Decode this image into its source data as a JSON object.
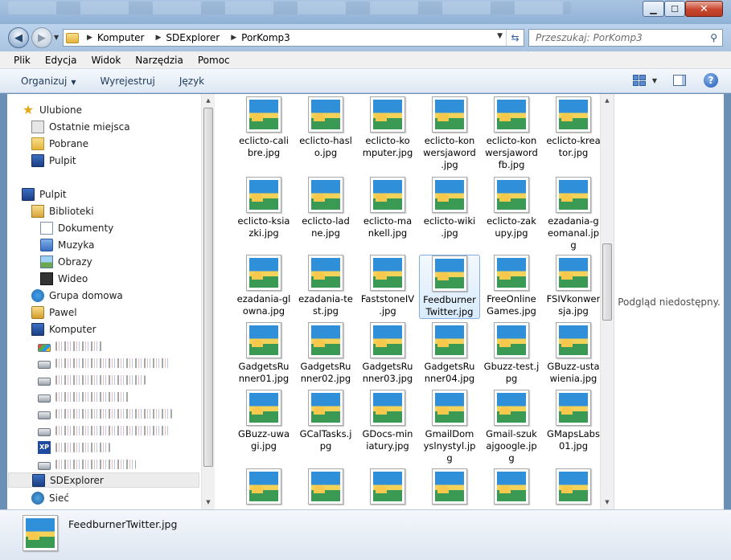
{
  "window": {
    "minimize": "▁",
    "maximize": "☐",
    "close": "✕"
  },
  "address": {
    "segments": [
      "Komputer",
      "SDExplorer",
      "PorKomp3"
    ]
  },
  "search": {
    "placeholder": "Przeszukaj: PorKomp3"
  },
  "menu": [
    "Plik",
    "Edycja",
    "Widok",
    "Narzędzia",
    "Pomoc"
  ],
  "toolbar": {
    "organize": "Organizuj",
    "eject": "Wyrejestruj",
    "language": "Język"
  },
  "nav": {
    "favorites": "Ulubione",
    "recent": "Ostatnie miejsca",
    "downloads": "Pobrane",
    "desktop_fav": "Pulpit",
    "desktop": "Pulpit",
    "libraries": "Biblioteki",
    "documents": "Dokumenty",
    "music": "Muzyka",
    "pictures": "Obrazy",
    "video": "Wideo",
    "homegroup": "Grupa domowa",
    "user": "Pawel",
    "computer": "Komputer",
    "sdexplorer": "SDExplorer",
    "network": "Sieć"
  },
  "files": [
    "eclicto-calibre.jpg",
    "eclicto-haslo.jpg",
    "eclicto-komputer.jpg",
    "eclicto-konwersjaword.jpg",
    "eclicto-konwersjawordfb.jpg",
    "eclicto-kreator.jpg",
    "eclicto-ksiazki.jpg",
    "eclicto-ladne.jpg",
    "eclicto-mankell.jpg",
    "eclicto-wiki.jpg",
    "eclicto-zakupy.jpg",
    "ezadania-geomanal.jpg",
    "ezadania-glowna.jpg",
    "ezadania-test.jpg",
    "FaststoneIV.jpg",
    "FeedburnerTwitter.jpg",
    "FreeOnlineGames.jpg",
    "FSIVkonwersja.jpg",
    "GadgetsRunner01.jpg",
    "GadgetsRunner02.jpg",
    "GadgetsRunner03.jpg",
    "GadgetsRunner04.jpg",
    "Gbuzz-test.jpg",
    "GBuzz-ustawienia.jpg",
    "GBuzz-uwagi.jpg",
    "GCalTasks.jpg",
    "GDocs-miniatury.jpg",
    "GmailDomyslnystyl.jpg",
    "Gmail-szukajgoogle.jpg",
    "GMapsLabs01.jpg"
  ],
  "file_labels": [
    [
      "eclicto-cali",
      "bre.jpg"
    ],
    [
      "eclicto-hasl",
      "o.jpg"
    ],
    [
      "eclicto-ko",
      "mputer.jpg"
    ],
    [
      "eclicto-kon",
      "wersjaword",
      ".jpg"
    ],
    [
      "eclicto-kon",
      "wersjaword",
      "fb.jpg"
    ],
    [
      "eclicto-krea",
      "tor.jpg"
    ],
    [
      "eclicto-ksia",
      "zki.jpg"
    ],
    [
      "eclicto-lad",
      "ne.jpg"
    ],
    [
      "eclicto-ma",
      "nkell.jpg"
    ],
    [
      "eclicto-wiki",
      ".jpg"
    ],
    [
      "eclicto-zak",
      "upy.jpg"
    ],
    [
      "ezadania-g",
      "eomanal.jp",
      "g"
    ],
    [
      "ezadania-gl",
      "owna.jpg"
    ],
    [
      "ezadania-te",
      "st.jpg"
    ],
    [
      "FaststoneIV",
      ".jpg"
    ],
    [
      "Feedburner",
      "Twitter.jpg"
    ],
    [
      "FreeOnline",
      "Games.jpg"
    ],
    [
      "FSIVkonwer",
      "sja.jpg"
    ],
    [
      "GadgetsRu",
      "nner01.jpg"
    ],
    [
      "GadgetsRu",
      "nner02.jpg"
    ],
    [
      "GadgetsRu",
      "nner03.jpg"
    ],
    [
      "GadgetsRu",
      "nner04.jpg"
    ],
    [
      "Gbuzz-test.j",
      "pg"
    ],
    [
      "GBuzz-usta",
      "wienia.jpg"
    ],
    [
      "GBuzz-uwa",
      "gi.jpg"
    ],
    [
      "GCalTasks.j",
      "pg"
    ],
    [
      "GDocs-min",
      "iatury.jpg"
    ],
    [
      "GmailDom",
      "yslnystyl.jp",
      "g"
    ],
    [
      "Gmail-szuk",
      "ajgoogle.jp",
      "g"
    ],
    [
      "GMapsLabs",
      "01.jpg"
    ]
  ],
  "selected_index": 15,
  "preview": {
    "message": "Podgląd niedostępny."
  },
  "details": {
    "filename": "FeedburnerTwitter.jpg"
  }
}
